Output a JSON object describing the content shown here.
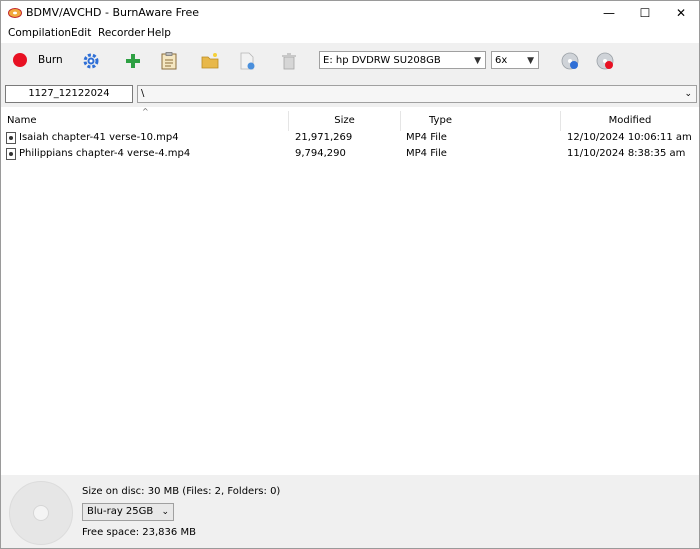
{
  "window": {
    "title": "BDMV/AVCHD - BurnAware Free",
    "minimize_glyph": "—",
    "maximize_glyph": "☐",
    "close_glyph": "✕"
  },
  "menu": {
    "items": [
      "Compilation",
      "Edit",
      "Recorder",
      "Help"
    ]
  },
  "toolbar": {
    "burn_label": "Burn",
    "drive_select": "E: hp DVDRW  SU208GB",
    "speed_select": "6x",
    "colors": {
      "burn_red": "#e81123",
      "add_green": "#2ea043",
      "gear_blue": "#2f6fd6",
      "folder_yellow": "#e8b84a"
    }
  },
  "pathbar": {
    "compilation_name": "1127_12122024",
    "current_path": "\\"
  },
  "list": {
    "columns": [
      "Name",
      "Size",
      "Type",
      "Modified"
    ],
    "rows": [
      {
        "name": "Isaiah chapter-41 verse-10.mp4",
        "size": "21,971,269",
        "type": "MP4 File",
        "modified": "12/10/2024 10:06:11 am"
      },
      {
        "name": "Philippians chapter-4 verse-4.mp4",
        "size": "9,794,290",
        "type": "MP4 File",
        "modified": "11/10/2024 8:38:35 am"
      }
    ]
  },
  "status": {
    "size_on_disc": "Size on disc: 30 MB (Files: 2, Folders: 0)",
    "disc_type": "Blu-ray 25GB",
    "free_space": "Free space: 23,836 MB"
  }
}
